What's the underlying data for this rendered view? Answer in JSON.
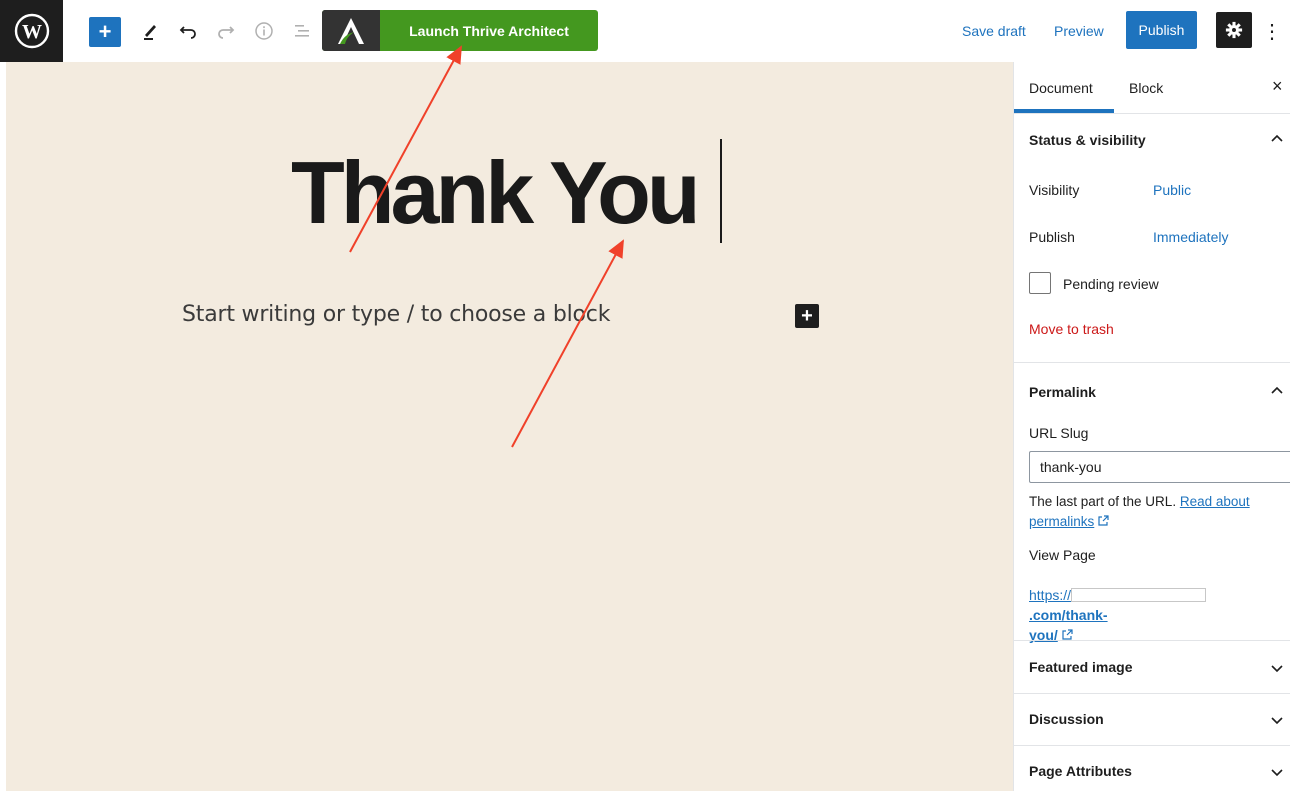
{
  "toolbar": {
    "thrive_label": "Launch Thrive Architect",
    "save_draft": "Save draft",
    "preview": "Preview",
    "publish": "Publish"
  },
  "editor": {
    "title": "Thank You",
    "placeholder": "Start writing or type / to choose a block"
  },
  "sidebar": {
    "tabs": {
      "document": "Document",
      "block": "Block"
    },
    "status": {
      "heading": "Status & visibility",
      "visibility_label": "Visibility",
      "visibility_value": "Public",
      "publish_label": "Publish",
      "publish_value": "Immediately",
      "pending_review": "Pending review",
      "move_to_trash": "Move to trash"
    },
    "permalink": {
      "heading": "Permalink",
      "url_slug_label": "URL Slug",
      "url_slug_value": "thank-you",
      "help_text": "The last part of the URL.",
      "help_link_1": "Read about",
      "help_link_2": "permalinks",
      "view_page_label": "View Page",
      "url_prefix": "https://",
      "url_suffix_1": ".com/thank-",
      "url_suffix_2": "you/"
    },
    "panels": {
      "featured_image": "Featured image",
      "discussion": "Discussion",
      "page_attributes": "Page Attributes"
    }
  },
  "colors": {
    "accent_blue": "#1e73be",
    "thrive_green": "#44981f",
    "canvas_bg": "#f3ebdf",
    "trash_red": "#cc1818",
    "annotation_arrow": "#f0412a"
  },
  "icons": [
    "wordpress-logo-icon",
    "plus-icon",
    "pencil-icon",
    "undo-icon",
    "redo-icon",
    "info-icon",
    "list-view-icon",
    "thrive-logo-icon",
    "gear-icon",
    "more-vertical-icon",
    "close-icon",
    "chevron-up-icon",
    "chevron-down-icon",
    "external-link-icon"
  ]
}
